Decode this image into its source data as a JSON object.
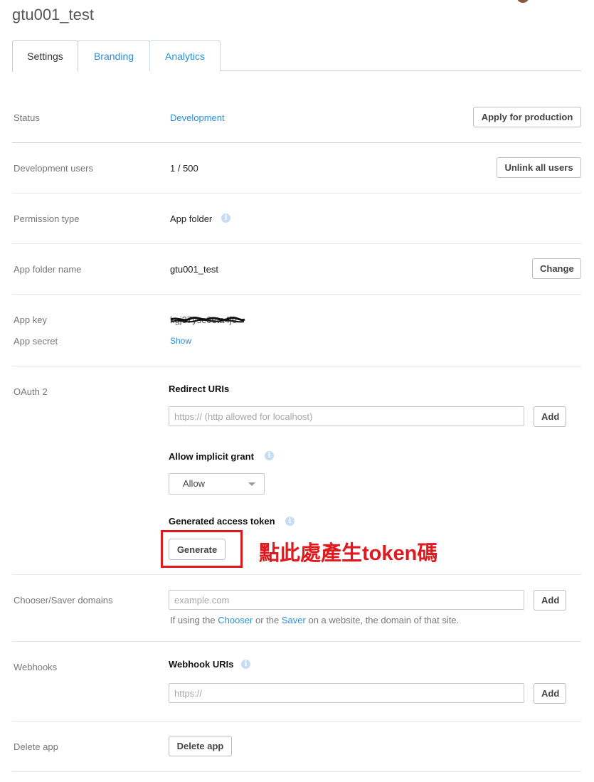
{
  "app": {
    "title": "gtu001_test"
  },
  "tabs": [
    {
      "label": "Settings",
      "active": true
    },
    {
      "label": "Branding",
      "active": false
    },
    {
      "label": "Analytics",
      "active": false
    }
  ],
  "status": {
    "label": "Status",
    "value": "Development",
    "button": "Apply for production"
  },
  "dev_users": {
    "label": "Development users",
    "value": "1 / 500",
    "button": "Unlink all users"
  },
  "permission": {
    "label": "Permission type",
    "value": "App folder"
  },
  "app_folder": {
    "label": "App folder name",
    "value": "gtu001_test",
    "button": "Change"
  },
  "app_key": {
    "label": "App key",
    "value": "kgj37yse0eta4je",
    "obscured": true
  },
  "app_secret": {
    "label": "App secret",
    "link": "Show"
  },
  "oauth": {
    "label": "OAuth 2",
    "redirect_title": "Redirect URIs",
    "redirect_placeholder": "https:// (http allowed for localhost)",
    "add_button": "Add",
    "implicit_title": "Allow implicit grant",
    "implicit_value": "Allow",
    "token_title": "Generated access token",
    "generate_button": "Generate"
  },
  "annotation": {
    "text": "點此處產生token碼",
    "color": "#e0191f"
  },
  "chooser": {
    "label": "Chooser/Saver domains",
    "placeholder": "example.com",
    "add_button": "Add",
    "help_prefix": "If using the",
    "help_link1": "Chooser",
    "help_mid": "or the",
    "help_link2": "Saver",
    "help_suffix": "on a website, the domain of that site."
  },
  "webhooks": {
    "label": "Webhooks",
    "title": "Webhook URIs",
    "placeholder": "https://",
    "add_button": "Add"
  },
  "delete": {
    "label": "Delete app",
    "button": "Delete app"
  },
  "colors": {
    "accent": "#2a8fd8",
    "annotation": "#e0191f",
    "label": "#777777"
  },
  "icons": {
    "info": "info-icon",
    "dropdown": "chevron-down-icon"
  }
}
